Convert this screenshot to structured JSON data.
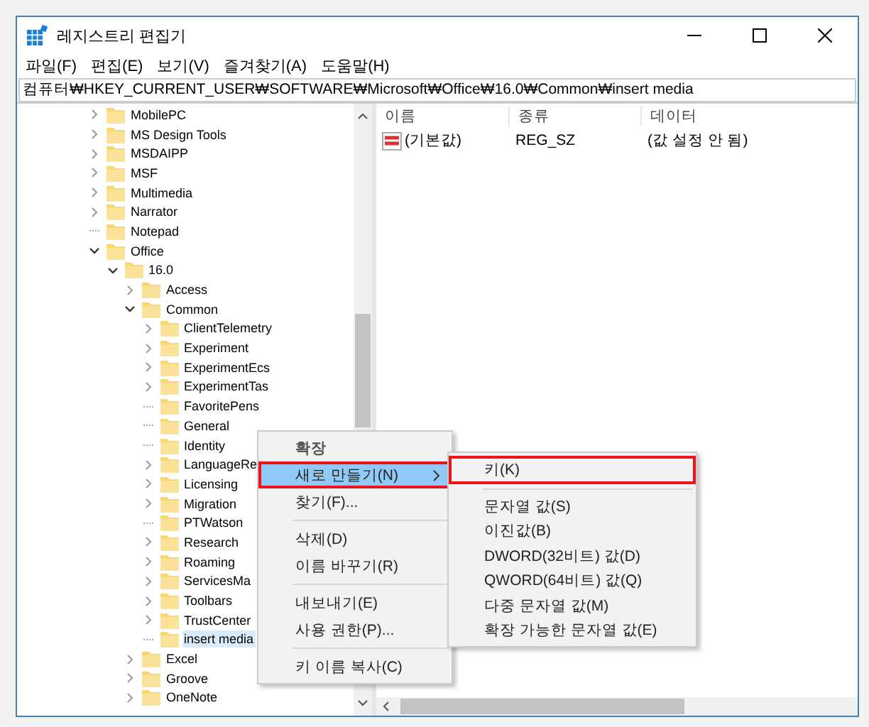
{
  "window": {
    "title": "레지스트리 편집기"
  },
  "menu_bar": [
    {
      "label": "파일(F)"
    },
    {
      "label": "편집(E)"
    },
    {
      "label": "보기(V)"
    },
    {
      "label": "즐겨찾기(A)"
    },
    {
      "label": "도움말(H)"
    }
  ],
  "address_bar": {
    "value": "컴퓨터₩HKEY_CURRENT_USER₩SOFTWARE₩Microsoft₩Office₩16.0₩Common₩insert media"
  },
  "tree": [
    {
      "label": "MobilePC",
      "expandable": true,
      "expanded": false,
      "selected": false
    },
    {
      "label": "MS Design Tools",
      "expandable": true,
      "expanded": false,
      "selected": false
    },
    {
      "label": "MSDAIPP",
      "expandable": true,
      "expanded": false,
      "selected": false
    },
    {
      "label": "MSF",
      "expandable": true,
      "expanded": false,
      "selected": false
    },
    {
      "label": "Multimedia",
      "expandable": true,
      "expanded": false,
      "selected": false
    },
    {
      "label": "Narrator",
      "expandable": true,
      "expanded": false,
      "selected": false
    },
    {
      "label": "Notepad",
      "expandable": false,
      "selected": false
    },
    {
      "label": "Office",
      "expandable": true,
      "expanded": true,
      "selected": false,
      "children": [
        {
          "label": "16.0",
          "expandable": true,
          "expanded": true,
          "selected": false,
          "children": [
            {
              "label": "Access",
              "expandable": true,
              "expanded": false,
              "selected": false
            },
            {
              "label": "Common",
              "expandable": true,
              "expanded": true,
              "selected": false,
              "children": [
                {
                  "label": "ClientTelemetry",
                  "expandable": true,
                  "expanded": false,
                  "selected": false
                },
                {
                  "label": "Experiment",
                  "expandable": true,
                  "expanded": false,
                  "selected": false
                },
                {
                  "label": "ExperimentEcs",
                  "expandable": true,
                  "expanded": false,
                  "selected": false
                },
                {
                  "label": "ExperimentTas",
                  "expandable": true,
                  "expanded": false,
                  "selected": false
                },
                {
                  "label": "FavoritePens",
                  "expandable": false,
                  "selected": false
                },
                {
                  "label": "General",
                  "expandable": false,
                  "selected": false
                },
                {
                  "label": "Identity",
                  "expandable": false,
                  "selected": false
                },
                {
                  "label": "LanguageRe",
                  "expandable": true,
                  "expanded": false,
                  "selected": false
                },
                {
                  "label": "Licensing",
                  "expandable": true,
                  "expanded": false,
                  "selected": false
                },
                {
                  "label": "Migration",
                  "expandable": true,
                  "expanded": false,
                  "selected": false
                },
                {
                  "label": "PTWatson",
                  "expandable": false,
                  "selected": false
                },
                {
                  "label": "Research",
                  "expandable": true,
                  "expanded": false,
                  "selected": false
                },
                {
                  "label": "Roaming",
                  "expandable": true,
                  "expanded": false,
                  "selected": false
                },
                {
                  "label": "ServicesMa",
                  "expandable": true,
                  "expanded": false,
                  "selected": false
                },
                {
                  "label": "Toolbars",
                  "expandable": true,
                  "expanded": false,
                  "selected": false
                },
                {
                  "label": "TrustCenter",
                  "expandable": true,
                  "expanded": false,
                  "selected": false
                },
                {
                  "label": "insert media",
                  "expandable": false,
                  "selected": true
                }
              ]
            },
            {
              "label": "Excel",
              "expandable": true,
              "expanded": false,
              "selected": false
            },
            {
              "label": "Groove",
              "expandable": true,
              "expanded": false,
              "selected": false
            },
            {
              "label": "OneNote",
              "expandable": true,
              "expanded": false,
              "selected": false
            }
          ]
        }
      ]
    }
  ],
  "values_table": {
    "columns": [
      "이름",
      "종류",
      "데이터"
    ],
    "rows": [
      {
        "name": "(기본값)",
        "type": "REG_SZ",
        "data": "(값 설정 안 됨)"
      }
    ]
  },
  "context_menu": {
    "groups": [
      [
        {
          "label": "확장",
          "kind": "default",
          "selected": false,
          "submenu": false,
          "annotated": false
        },
        {
          "label": "새로 만들기(N)",
          "kind": "normal",
          "selected": true,
          "submenu": true,
          "annotated": true
        },
        {
          "label": "찾기(F)...",
          "kind": "normal",
          "selected": false,
          "submenu": false,
          "annotated": false
        }
      ],
      [
        {
          "label": "삭제(D)",
          "kind": "normal",
          "selected": false,
          "submenu": false,
          "annotated": false
        },
        {
          "label": "이름 바꾸기(R)",
          "kind": "normal",
          "selected": false,
          "submenu": false,
          "annotated": false
        }
      ],
      [
        {
          "label": "내보내기(E)",
          "kind": "normal",
          "selected": false,
          "submenu": false,
          "annotated": false
        },
        {
          "label": "사용 권한(P)...",
          "kind": "normal",
          "selected": false,
          "submenu": false,
          "annotated": false
        }
      ],
      [
        {
          "label": "키 이름 복사(C)",
          "kind": "normal",
          "selected": false,
          "submenu": false,
          "annotated": false
        }
      ]
    ]
  },
  "submenu": {
    "groups": [
      [
        {
          "label": "키(K)",
          "annotated": true
        }
      ],
      [
        {
          "label": "문자열 값(S)",
          "annotated": false
        },
        {
          "label": "이진값(B)",
          "annotated": false
        },
        {
          "label": "DWORD(32비트) 값(D)",
          "annotated": false
        },
        {
          "label": "QWORD(64비트) 값(Q)",
          "annotated": false
        },
        {
          "label": "다중 문자열 값(M)",
          "annotated": false
        },
        {
          "label": "확장 가능한 문자열 값(E)",
          "annotated": false
        }
      ]
    ]
  }
}
